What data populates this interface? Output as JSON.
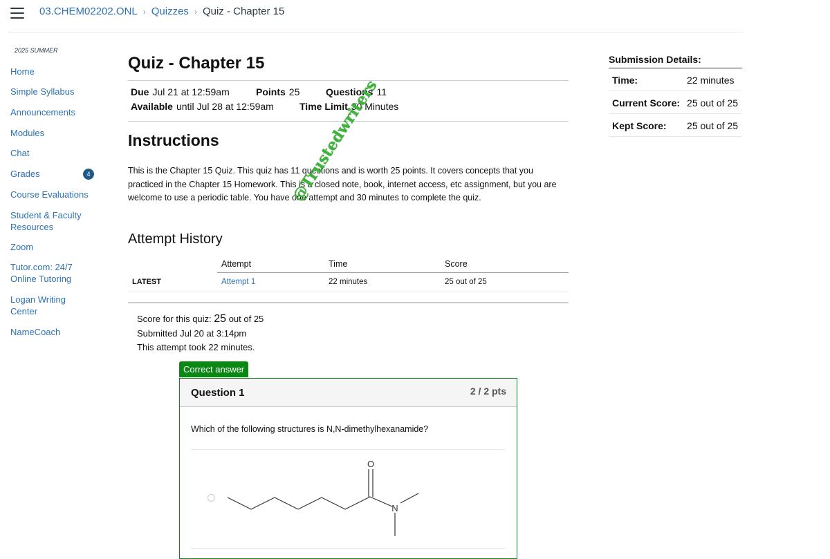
{
  "breadcrumb": {
    "course": "03.CHEM02202.ONL",
    "section": "Quizzes",
    "current": "Quiz - Chapter 15"
  },
  "sidebar": {
    "term": "2025 SUMMER",
    "items": [
      {
        "label": "Home"
      },
      {
        "label": "Simple Syllabus"
      },
      {
        "label": "Announcements"
      },
      {
        "label": "Modules"
      },
      {
        "label": "Chat"
      },
      {
        "label": "Grades",
        "badge": "4"
      },
      {
        "label": "Course Evaluations"
      },
      {
        "label": "Student & Faculty Resources"
      },
      {
        "label": "Zoom"
      },
      {
        "label": "Tutor.com: 24/7 Online Tutoring"
      },
      {
        "label": "Logan Writing Center"
      },
      {
        "label": "NameCoach"
      }
    ]
  },
  "quiz": {
    "title": "Quiz - Chapter 15",
    "due_label": "Due",
    "due_value": "Jul 21 at 12:59am",
    "points_label": "Points",
    "points_value": "25",
    "questions_label": "Questions",
    "questions_value": "11",
    "available_label": "Available",
    "available_value": "until Jul 28 at 12:59am",
    "time_limit_label": "Time Limit",
    "time_limit_value": "30 Minutes",
    "instructions_heading": "Instructions",
    "instructions_text": "This is the Chapter 15 Quiz.  This quiz has 11 questions and is worth 25 points.  It covers concepts that you practiced in the Chapter 15 Homework.  This is a closed note, book, internet access, etc assignment, but you are welcome to use a periodic table. You have one attempt and 30 minutes to complete the quiz."
  },
  "watermark": "@Trustedwriters",
  "attempt_history": {
    "heading": "Attempt History",
    "columns": [
      "Attempt",
      "Time",
      "Score"
    ],
    "rows": [
      {
        "label": "LATEST",
        "attempt": "Attempt 1",
        "time": "22 minutes",
        "score": "25 out of 25"
      }
    ]
  },
  "result": {
    "score_prefix": "Score for this quiz: ",
    "score_value": "25",
    "score_suffix": " out of 25",
    "submitted": "Submitted Jul 20 at 3:14pm",
    "duration": "This attempt took 22 minutes."
  },
  "question": {
    "tag": "Correct answer",
    "title": "Question 1",
    "points": "2 / 2 pts",
    "text": "Which of the following structures is N,N-dimethylhexanamide?",
    "atom_o": "O",
    "atom_n": "N"
  },
  "submission": {
    "title": "Submission Details:",
    "rows": [
      {
        "label": "Time:",
        "value": "22 minutes"
      },
      {
        "label": "Current Score:",
        "value": "25 out of 25"
      },
      {
        "label": "Kept Score:",
        "value": "25 out of 25"
      }
    ]
  }
}
